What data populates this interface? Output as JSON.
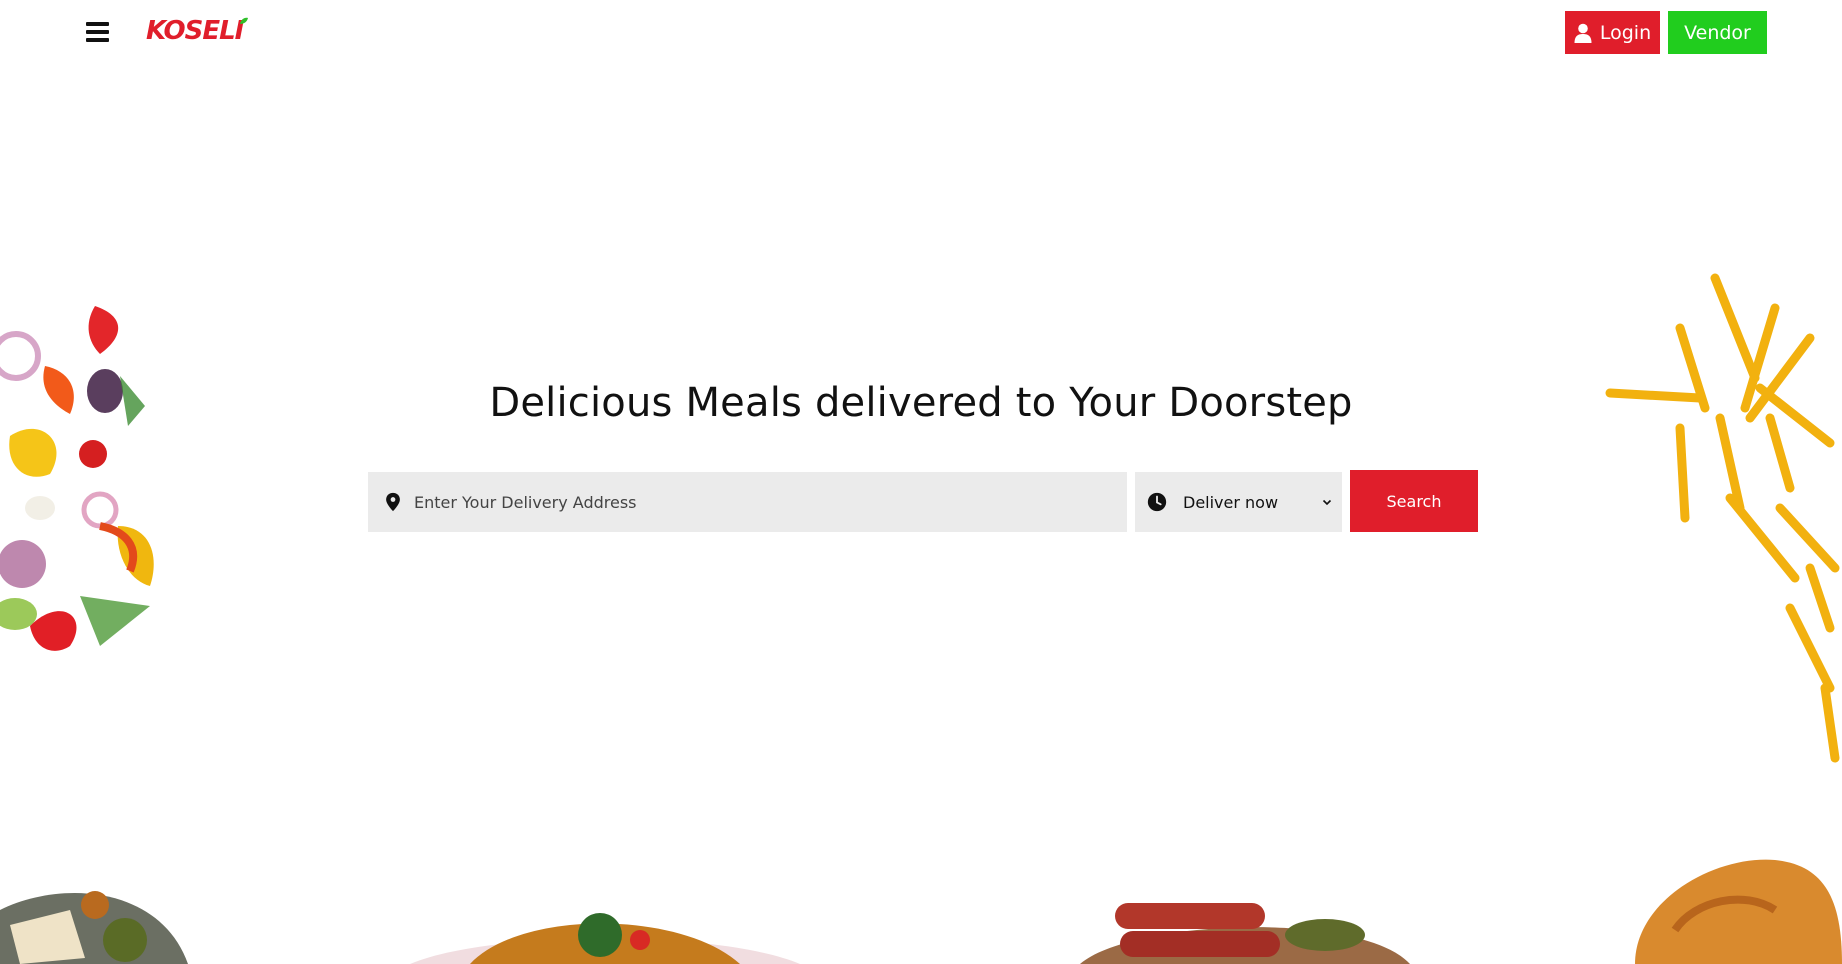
{
  "header": {
    "logo_text": "KOSELI",
    "login_label": "Login",
    "vendor_label": "Vendor"
  },
  "hero": {
    "title": "Delicious Meals delivered to Your Doorstep",
    "address_placeholder": "Enter Your Delivery Address",
    "delivery_time": "Deliver now",
    "search_label": "Search"
  },
  "colors": {
    "brand_red": "#e01e2b",
    "vendor_green": "#21cd1e",
    "input_gray": "#ebebeb"
  },
  "icons": {
    "menu": "hamburger-menu-icon",
    "user": "user-icon",
    "location": "location-pin-icon",
    "clock": "clock-icon",
    "dropdown": "chevron-down-icon"
  }
}
